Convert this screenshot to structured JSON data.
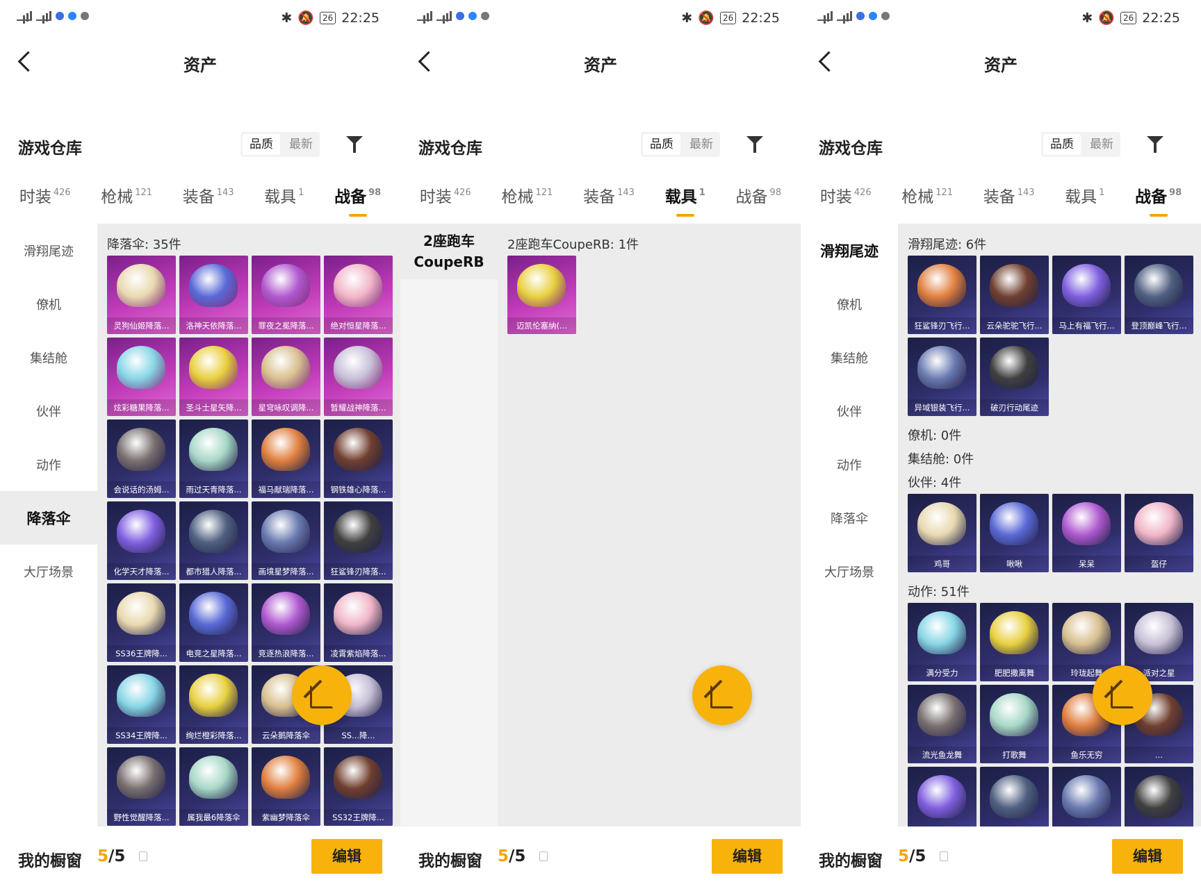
{
  "status": {
    "time": "22:25",
    "battery": "26"
  },
  "colors": {
    "accent": "#f8b20c",
    "tile_purple": "#c03bb8",
    "tile_blue": "#2f2e6a"
  },
  "panels": [
    {
      "title": "资产",
      "section": "游戏仓库",
      "sort": [
        "品质",
        "最新"
      ],
      "tabs": [
        {
          "label": "时装",
          "count": "426"
        },
        {
          "label": "枪械",
          "count": "121"
        },
        {
          "label": "装备",
          "count": "143"
        },
        {
          "label": "载具",
          "count": "1"
        },
        {
          "label": "战备",
          "count": "98"
        }
      ],
      "active_tab": 4,
      "sidebar": [
        "滑翔尾迹",
        "僚机",
        "集结舱",
        "伙伴",
        "动作",
        "降落伞",
        "大厅场景"
      ],
      "active_side": 5,
      "groups": [
        {
          "title": "降落伞: 35件",
          "items": [
            {
              "name": "灵狗仙姬降落...",
              "style": "purple"
            },
            {
              "name": "洛神天依降落...",
              "style": "purple"
            },
            {
              "name": "罪夜之冕降落...",
              "style": "purple"
            },
            {
              "name": "绝对恒星降落...",
              "style": "purple"
            },
            {
              "name": "炫彩糖果降落...",
              "style": "purple"
            },
            {
              "name": "圣斗士星矢降...",
              "style": "purple"
            },
            {
              "name": "星穹咏叹调降...",
              "style": "purple"
            },
            {
              "name": "暂耀战神降落...",
              "style": "purple"
            },
            {
              "name": "会说话的汤姆...",
              "style": "blue"
            },
            {
              "name": "雨过天青降落...",
              "style": "blue"
            },
            {
              "name": "福马献瑞降落...",
              "style": "blue"
            },
            {
              "name": "钢铁雄心降落...",
              "style": "blue"
            },
            {
              "name": "化学天才降落...",
              "style": "blue"
            },
            {
              "name": "都市猎人降落...",
              "style": "blue"
            },
            {
              "name": "画境星梦降落...",
              "style": "blue"
            },
            {
              "name": "狂鲨锋刃降落...",
              "style": "blue"
            },
            {
              "name": "SS36王牌降...",
              "style": "blue"
            },
            {
              "name": "电竞之星降落...",
              "style": "blue"
            },
            {
              "name": "竞逐热浪降落...",
              "style": "blue"
            },
            {
              "name": "凌霄紫焰降落...",
              "style": "blue"
            },
            {
              "name": "SS34王牌降...",
              "style": "blue"
            },
            {
              "name": "绚烂橙彩降落...",
              "style": "blue"
            },
            {
              "name": "云朵鹅降落伞",
              "style": "blue"
            },
            {
              "name": "SS...降...",
              "style": "blue"
            },
            {
              "name": "野性觉醒降落...",
              "style": "blue"
            },
            {
              "name": "属我最6降落伞",
              "style": "blue"
            },
            {
              "name": "紫幽梦降落伞",
              "style": "blue"
            },
            {
              "name": "SS32王牌降...",
              "style": "blue"
            }
          ]
        }
      ],
      "footer": {
        "label": "我的橱窗",
        "used": "5",
        "total": "/5",
        "edit": "编辑"
      }
    },
    {
      "title": "资产",
      "section": "游戏仓库",
      "sort": [
        "品质",
        "最新"
      ],
      "tabs": [
        {
          "label": "时装",
          "count": "426"
        },
        {
          "label": "枪械",
          "count": "121"
        },
        {
          "label": "装备",
          "count": "143"
        },
        {
          "label": "载具",
          "count": "1"
        },
        {
          "label": "战备",
          "count": "98"
        }
      ],
      "active_tab": 3,
      "sidebar": [
        "2座跑车 CoupeRB"
      ],
      "active_side": 0,
      "groups": [
        {
          "title": "2座跑车CoupeRB: 1件",
          "items": [
            {
              "name": "迈凯伦塞纳(...",
              "style": "purple"
            }
          ]
        }
      ],
      "footer": {
        "label": "我的橱窗",
        "used": "5",
        "total": "/5",
        "edit": "编辑"
      }
    },
    {
      "title": "资产",
      "section": "游戏仓库",
      "sort": [
        "品质",
        "最新"
      ],
      "tabs": [
        {
          "label": "时装",
          "count": "426"
        },
        {
          "label": "枪械",
          "count": "121"
        },
        {
          "label": "装备",
          "count": "143"
        },
        {
          "label": "载具",
          "count": "1"
        },
        {
          "label": "战备",
          "count": "98"
        }
      ],
      "active_tab": 4,
      "sidebar": [
        "滑翔尾迹",
        "僚机",
        "集结舱",
        "伙伴",
        "动作",
        "降落伞",
        "大厅场景"
      ],
      "active_side": 0,
      "groups": [
        {
          "title": "滑翔尾迹: 6件",
          "items": [
            {
              "name": "狂鲨锋刃飞行...",
              "style": "blue"
            },
            {
              "name": "云朵驼驼飞行...",
              "style": "blue"
            },
            {
              "name": "马上有福飞行...",
              "style": "blue"
            },
            {
              "name": "登顶巅峰飞行...",
              "style": "blue"
            },
            {
              "name": "异域银装飞行...",
              "style": "blue"
            },
            {
              "name": "破刃行动尾迹",
              "style": "blue"
            }
          ]
        },
        {
          "title": "僚机: 0件",
          "items": []
        },
        {
          "title": "集结舱: 0件",
          "items": []
        },
        {
          "title": "伙伴: 4件",
          "items": [
            {
              "name": "鸡哥",
              "style": "blue"
            },
            {
              "name": "啾啾",
              "style": "blue"
            },
            {
              "name": "呆呆",
              "style": "blue"
            },
            {
              "name": "盔仔",
              "style": "blue"
            }
          ]
        },
        {
          "title": "动作: 51件",
          "items": [
            {
              "name": "满分受力",
              "style": "blue"
            },
            {
              "name": "肥肥撒离舞",
              "style": "blue"
            },
            {
              "name": "玲珑起舞",
              "style": "blue"
            },
            {
              "name": "派对之星",
              "style": "blue"
            },
            {
              "name": "流光鱼龙舞",
              "style": "blue"
            },
            {
              "name": "打歌舞",
              "style": "blue"
            },
            {
              "name": "鱼乐无穷",
              "style": "blue"
            },
            {
              "name": "...",
              "style": "blue"
            },
            {
              "name": "",
              "style": "blue"
            },
            {
              "name": "",
              "style": "blue"
            },
            {
              "name": "",
              "style": "blue"
            },
            {
              "name": "",
              "style": "blue"
            }
          ]
        }
      ],
      "footer": {
        "label": "我的橱窗",
        "used": "5",
        "total": "/5",
        "edit": "编辑"
      }
    }
  ]
}
